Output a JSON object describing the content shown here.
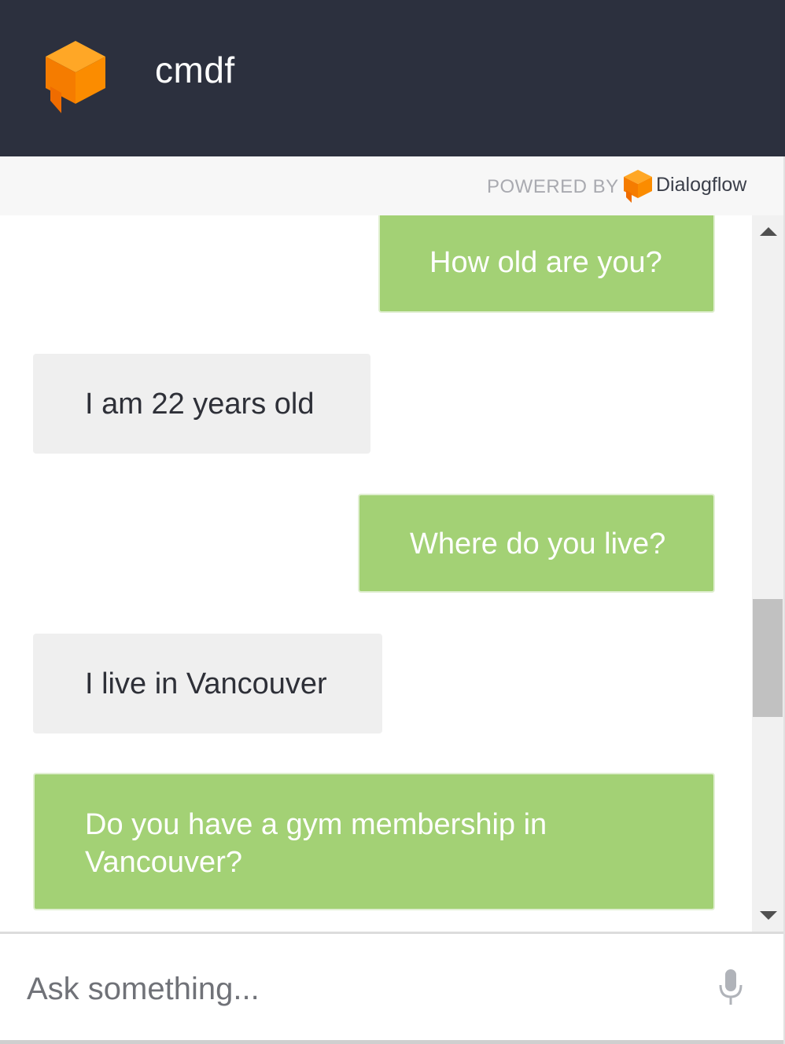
{
  "header": {
    "title": "cmdf",
    "logo_icon": "dialogflow-cube-icon",
    "background_color": "#2c303e"
  },
  "powered_by": {
    "label": "POWERED BY",
    "brand_name": "Dialogflow",
    "brand_icon": "dialogflow-cube-icon"
  },
  "conversation": {
    "messages": [
      {
        "sender": "user",
        "text": "How old are you?"
      },
      {
        "sender": "bot",
        "text": "I am 22 years old"
      },
      {
        "sender": "user",
        "text": "Where do you live?"
      },
      {
        "sender": "bot",
        "text": "I live in Vancouver"
      },
      {
        "sender": "user",
        "text": "Do you have a gym membership in Vancouver?"
      }
    ]
  },
  "composer": {
    "placeholder": "Ask something...",
    "mic_icon": "microphone-icon"
  },
  "colors": {
    "user_bubble": "#a3d175",
    "bot_bubble": "#efefef",
    "accent": "#f58a07"
  }
}
